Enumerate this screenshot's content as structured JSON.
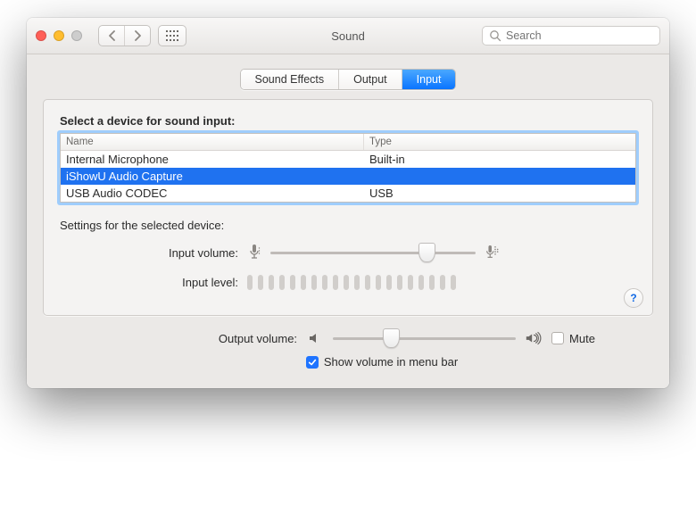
{
  "header": {
    "title": "Sound",
    "search_placeholder": "Search"
  },
  "tabs": [
    {
      "label": "Sound Effects",
      "active": false
    },
    {
      "label": "Output",
      "active": false
    },
    {
      "label": "Input",
      "active": true
    }
  ],
  "panel": {
    "heading": "Select a device for sound input:",
    "columns": {
      "name": "Name",
      "type": "Type"
    },
    "devices": [
      {
        "name": "Internal Microphone",
        "type": "Built-in",
        "selected": false
      },
      {
        "name": "iShowU Audio Capture",
        "type": "",
        "selected": true
      },
      {
        "name": "USB Audio CODEC",
        "type": "USB",
        "selected": false
      }
    ],
    "settings_heading": "Settings for the selected device:",
    "input_volume_label": "Input volume:",
    "input_volume_percent": 78,
    "input_level_label": "Input level:",
    "input_level_segments": 20,
    "input_level_active": 0
  },
  "footer": {
    "output_volume_label": "Output volume:",
    "output_volume_percent": 30,
    "mute_label": "Mute",
    "mute_checked": false,
    "show_label": "Show volume in menu bar",
    "show_checked": true
  },
  "icons": {
    "help": "?",
    "back": "‹",
    "forward": "›"
  },
  "colors": {
    "accent": "#1f74ff",
    "focus_ring": "#9fcdfc",
    "panel": "#f4f3f2",
    "body": "#ebe9e7"
  }
}
